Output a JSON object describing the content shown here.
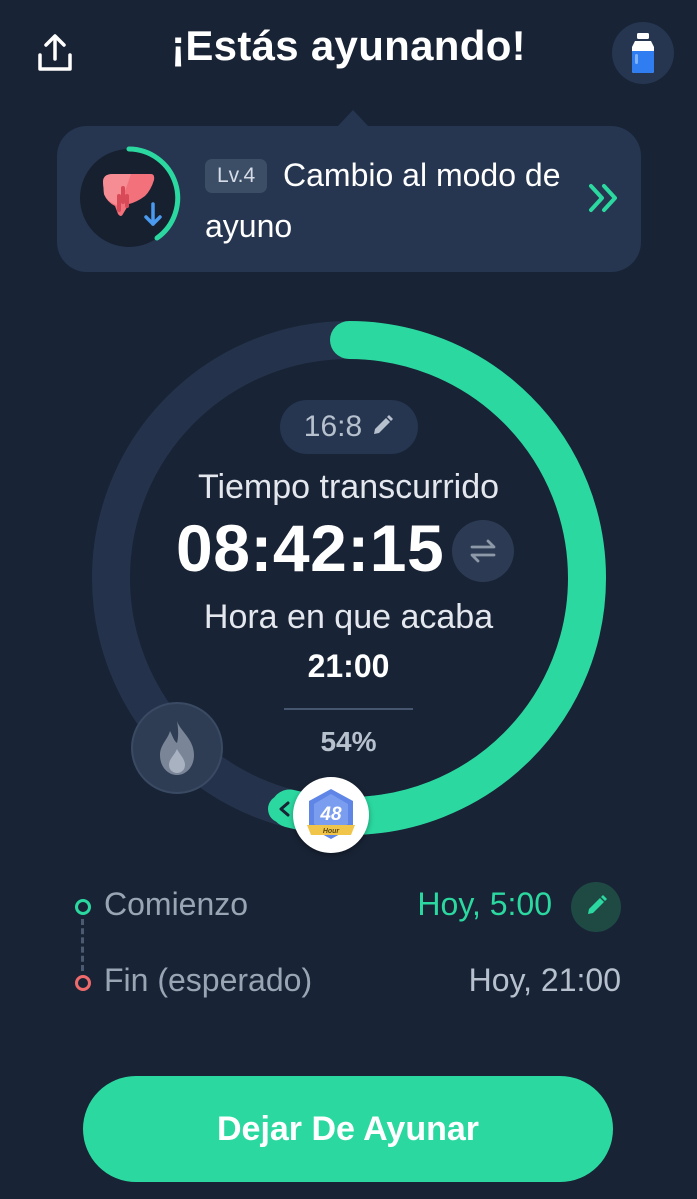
{
  "header": {
    "title": "¡Estás ayunando!",
    "share_icon": "share-upload-icon",
    "water_icon": "water-bottle-icon"
  },
  "level_card": {
    "badge": "Lv.4",
    "text_line1": "Cambio al modo de",
    "text_line2": "ayuno",
    "icon": "liver-icon",
    "chevron_icon": "double-chevron-right-icon"
  },
  "timer": {
    "plan": "16:8",
    "elapsed_label": "Tiempo transcurrido",
    "elapsed": "08:42:15",
    "end_label": "Hora en que acaba",
    "end_time": "21:00",
    "percent_text": "54%",
    "progress": 0.54,
    "badge_number": "48",
    "badge_caption": "Hour"
  },
  "schedule": {
    "start_label": "Comienzo",
    "start_value": "Hoy, 5:00",
    "end_label": "Fin (esperado)",
    "end_value": "Hoy, 21:00"
  },
  "cta": {
    "label": "Dejar De Ayunar"
  },
  "colors": {
    "background": "#182335",
    "card": "#263650",
    "accent": "#2bd9a0",
    "end_dot": "#ef6b6b"
  }
}
